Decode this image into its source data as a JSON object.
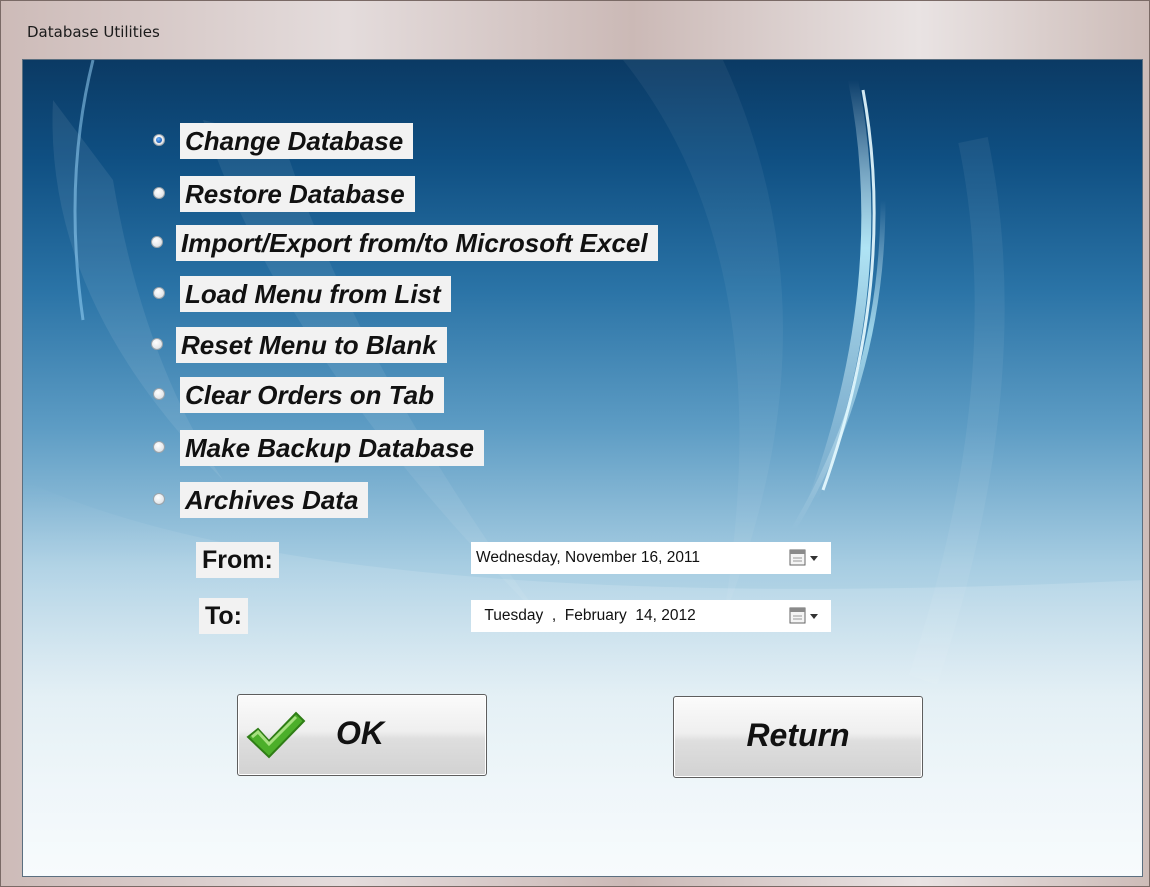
{
  "window": {
    "title": "Database Utilities"
  },
  "options": [
    {
      "label": "Change Database",
      "checked": true
    },
    {
      "label": "Restore Database",
      "checked": false
    },
    {
      "label": "Import/Export from/to Microsoft Excel",
      "checked": false
    },
    {
      "label": "Load Menu from List",
      "checked": false
    },
    {
      "label": "Reset Menu to Blank",
      "checked": false
    },
    {
      "label": "Clear Orders on Tab",
      "checked": false
    },
    {
      "label": "Make Backup Database",
      "checked": false
    },
    {
      "label": "Archives Data",
      "checked": false
    }
  ],
  "archive": {
    "from_label": "From:",
    "from_value": "Wednesday, November 16, 2011",
    "to_label": "To:",
    "to_value": "  Tuesday  ,  February  14, 2012"
  },
  "buttons": {
    "ok_label": "OK",
    "return_label": "Return"
  },
  "colors": {
    "accent": "#1b5fb8",
    "check": "#4caf2a"
  }
}
